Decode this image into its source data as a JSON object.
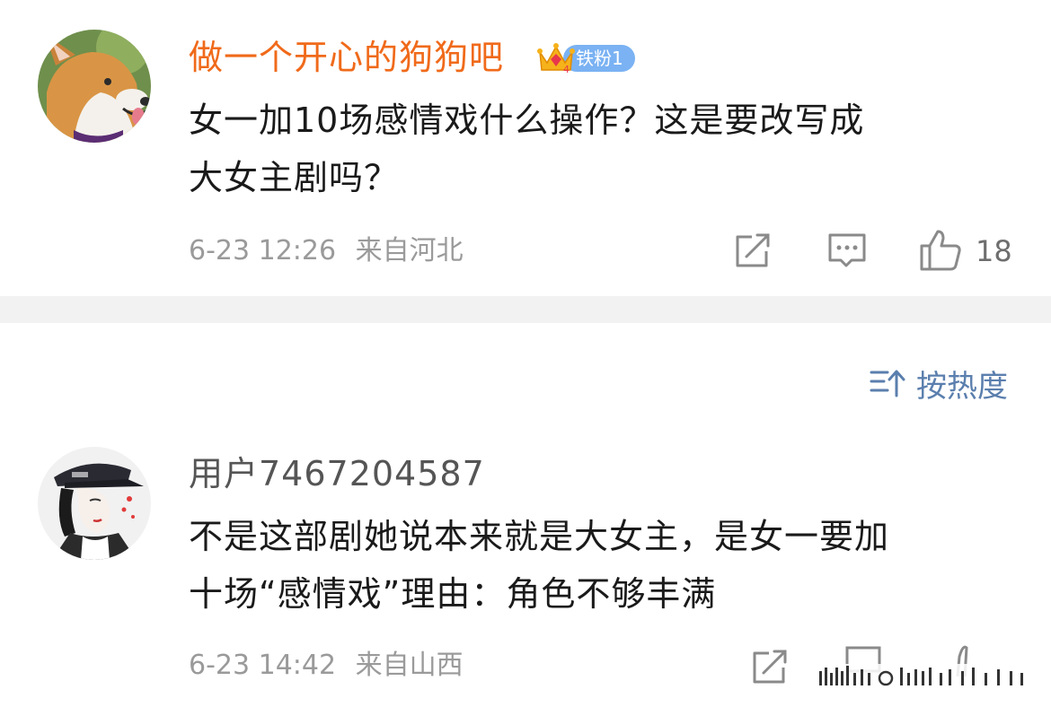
{
  "comments": [
    {
      "username": "做一个开心的狗狗吧",
      "badge": {
        "label": "铁粉1",
        "icon": "crown-icon"
      },
      "text_lines": [
        "女一加10场感情戏什么操作？这是要改写成",
        "大女主剧吗？"
      ],
      "time": "6-23 12:26",
      "location": "来自河北",
      "likes": "18",
      "username_color": "#f06a1a"
    },
    {
      "username": "用户7467204587",
      "text_lines": [
        "不是这部剧她说本来就是大女主，是女一要加",
        "十场“感情戏”理由：角色不够丰满"
      ],
      "time": "6-23 14:42",
      "location": "来自山西",
      "username_color": "#555555"
    }
  ],
  "sort": {
    "label": "按热度",
    "icon": "sort-icon"
  }
}
